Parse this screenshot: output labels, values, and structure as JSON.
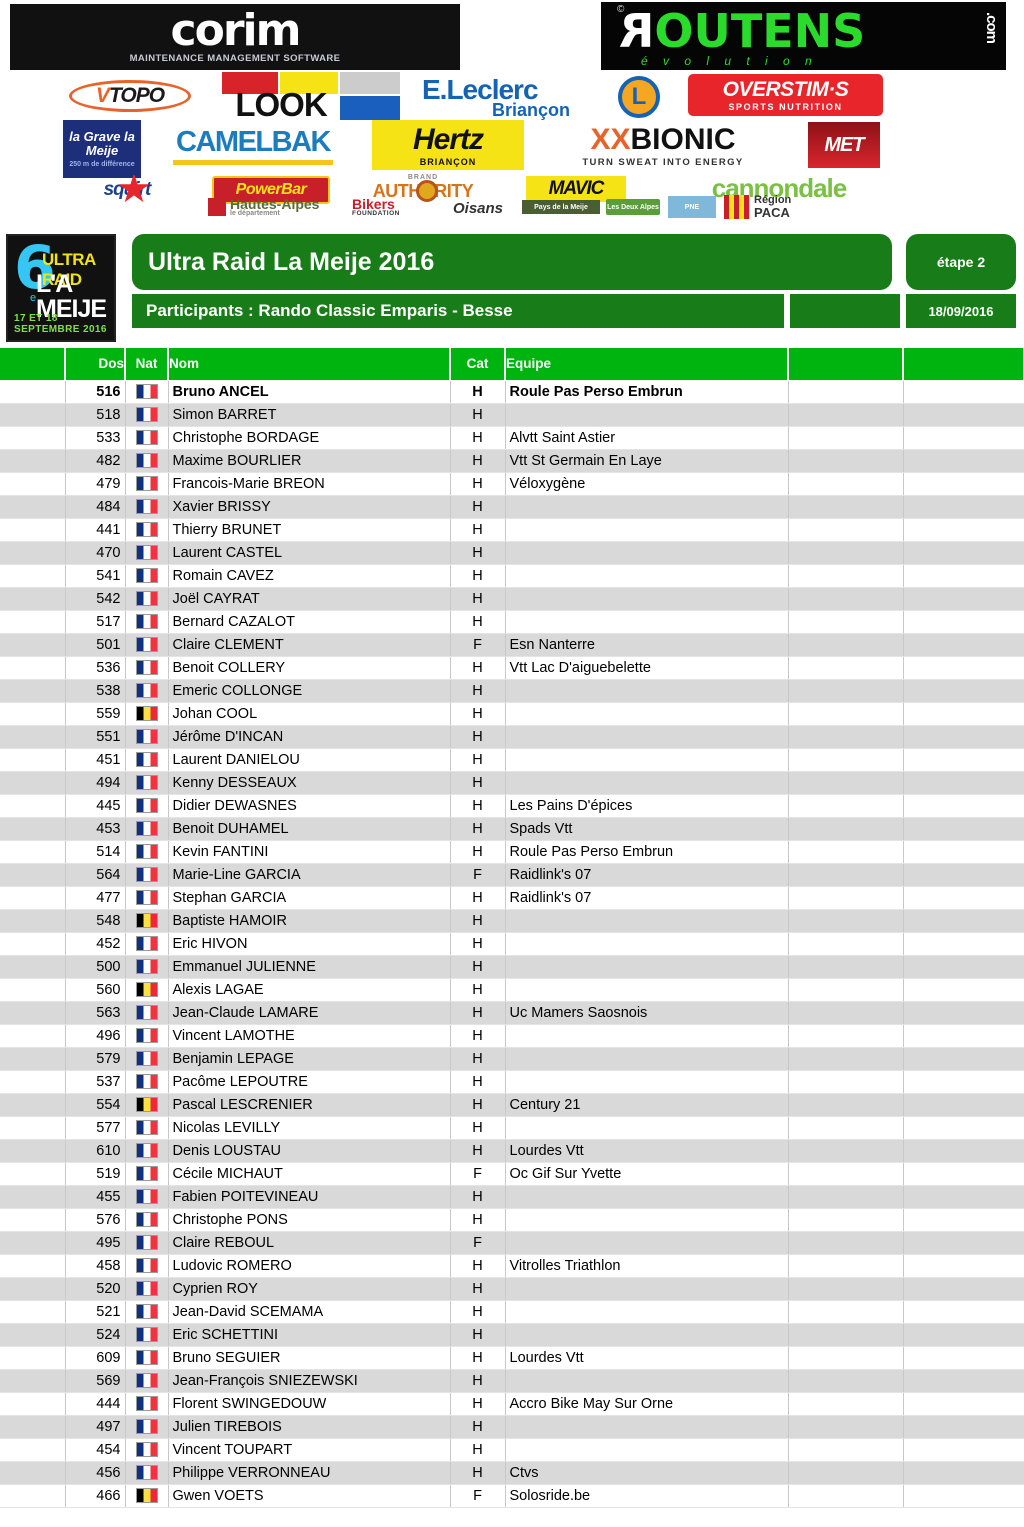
{
  "sponsors": {
    "corim": {
      "name": "corim",
      "tagline": "MAINTENANCE MANAGEMENT SOFTWARE"
    },
    "routens": {
      "name_part1": "R",
      "name_part2": "OUTENS",
      "suffix": ".com",
      "tagline": "é v o l u t i o n",
      "copyright": "©"
    },
    "vtopo": {
      "v": "V",
      "rest": "TOPO"
    },
    "look": {
      "name": "LOOK"
    },
    "leclerc": {
      "line1": "E.Leclerc",
      "line2": "Briançon",
      "mark": "L"
    },
    "overstims": {
      "line1": "OVERSTIM·S",
      "line2": "SPORTS NUTRITION"
    },
    "lagrave": {
      "line1": "la Grave la Meije",
      "line2": "250 m de différence"
    },
    "camelbak": {
      "name": "CAMELBAK"
    },
    "hertz": {
      "line1": "Hertz",
      "line2": "BRIANÇON"
    },
    "xbionic": {
      "x": "XX",
      "name": "BIONIC",
      "tagline": "TURN SWEAT INTO ENERGY"
    },
    "met": {
      "name": "MET"
    },
    "squirt": {
      "name": "squirt"
    },
    "powerbar": {
      "name": "PowerBar"
    },
    "authority": {
      "brand": "BRAND",
      "name": "AUTHORITY"
    },
    "mavic": {
      "name": "MAVIC"
    },
    "cannondale": {
      "name": "cannondale"
    },
    "hautes_alpes": {
      "line1": "Hautes-Alpes",
      "line2": "le département"
    },
    "bikers": {
      "line1": "Bikers",
      "line2": "FOUNDATION"
    },
    "oisans": {
      "name": "Oisans"
    },
    "green1": {
      "name": "Pays de la Meije"
    },
    "green2": {
      "name": "Les Deux Alpes"
    },
    "green3": {
      "name": "PNE"
    },
    "paca": {
      "line1": "Région",
      "line2": "PACA"
    }
  },
  "header": {
    "event_logo": {
      "number": "6",
      "ordinal": "e",
      "line1": "ULTRA RAID",
      "line2": "L'A MEIJE",
      "dates": "17 ET 18 SEPTEMBRE 2016"
    },
    "title": "Ultra Raid La Meije 2016",
    "stage": "étape 2",
    "subtitle": "Participants : Rando Classic Emparis - Besse",
    "blank_cell": "",
    "date": "18/09/2016"
  },
  "table": {
    "columns": [
      "",
      "Dos",
      "Nat",
      "Nom",
      "Cat",
      "Equipe",
      "",
      ""
    ],
    "rows": [
      {
        "blank": "",
        "dos": "516",
        "nat": "fr",
        "nom": "Bruno ANCEL",
        "cat": "H",
        "equipe": "Roule Pas Perso Embrun",
        "e1": "",
        "e2": "",
        "bold": true
      },
      {
        "blank": "",
        "dos": "518",
        "nat": "fr",
        "nom": "Simon BARRET",
        "cat": "H",
        "equipe": "",
        "e1": "",
        "e2": ""
      },
      {
        "blank": "",
        "dos": "533",
        "nat": "fr",
        "nom": "Christophe BORDAGE",
        "cat": "H",
        "equipe": "Alvtt Saint Astier",
        "e1": "",
        "e2": ""
      },
      {
        "blank": "",
        "dos": "482",
        "nat": "fr",
        "nom": "Maxime BOURLIER",
        "cat": "H",
        "equipe": "Vtt St Germain En Laye",
        "e1": "",
        "e2": ""
      },
      {
        "blank": "",
        "dos": "479",
        "nat": "fr",
        "nom": "Francois-Marie BREON",
        "cat": "H",
        "equipe": "Véloxygène",
        "e1": "",
        "e2": ""
      },
      {
        "blank": "",
        "dos": "484",
        "nat": "fr",
        "nom": "Xavier BRISSY",
        "cat": "H",
        "equipe": "",
        "e1": "",
        "e2": ""
      },
      {
        "blank": "",
        "dos": "441",
        "nat": "fr",
        "nom": "Thierry BRUNET",
        "cat": "H",
        "equipe": "",
        "e1": "",
        "e2": ""
      },
      {
        "blank": "",
        "dos": "470",
        "nat": "fr",
        "nom": "Laurent CASTEL",
        "cat": "H",
        "equipe": "",
        "e1": "",
        "e2": ""
      },
      {
        "blank": "",
        "dos": "541",
        "nat": "fr",
        "nom": "Romain CAVEZ",
        "cat": "H",
        "equipe": "",
        "e1": "",
        "e2": ""
      },
      {
        "blank": "",
        "dos": "542",
        "nat": "fr",
        "nom": "Joël CAYRAT",
        "cat": "H",
        "equipe": "",
        "e1": "",
        "e2": ""
      },
      {
        "blank": "",
        "dos": "517",
        "nat": "fr",
        "nom": "Bernard CAZALOT",
        "cat": "H",
        "equipe": "",
        "e1": "",
        "e2": ""
      },
      {
        "blank": "",
        "dos": "501",
        "nat": "fr",
        "nom": "Claire CLEMENT",
        "cat": "F",
        "equipe": "Esn Nanterre",
        "e1": "",
        "e2": ""
      },
      {
        "blank": "",
        "dos": "536",
        "nat": "fr",
        "nom": "Benoit COLLERY",
        "cat": "H",
        "equipe": "Vtt Lac D'aiguebelette",
        "e1": "",
        "e2": ""
      },
      {
        "blank": "",
        "dos": "538",
        "nat": "fr",
        "nom": "Emeric COLLONGE",
        "cat": "H",
        "equipe": "",
        "e1": "",
        "e2": ""
      },
      {
        "blank": "",
        "dos": "559",
        "nat": "be",
        "nom": "Johan COOL",
        "cat": "H",
        "equipe": "",
        "e1": "",
        "e2": ""
      },
      {
        "blank": "",
        "dos": "551",
        "nat": "fr",
        "nom": "Jérôme D'INCAN",
        "cat": "H",
        "equipe": "",
        "e1": "",
        "e2": ""
      },
      {
        "blank": "",
        "dos": "451",
        "nat": "fr",
        "nom": "Laurent DANIELOU",
        "cat": "H",
        "equipe": "",
        "e1": "",
        "e2": ""
      },
      {
        "blank": "",
        "dos": "494",
        "nat": "fr",
        "nom": "Kenny DESSEAUX",
        "cat": "H",
        "equipe": "",
        "e1": "",
        "e2": ""
      },
      {
        "blank": "",
        "dos": "445",
        "nat": "fr",
        "nom": "Didier DEWASNES",
        "cat": "H",
        "equipe": "Les Pains D'épices",
        "e1": "",
        "e2": ""
      },
      {
        "blank": "",
        "dos": "453",
        "nat": "fr",
        "nom": "Benoit DUHAMEL",
        "cat": "H",
        "equipe": "Spads Vtt",
        "e1": "",
        "e2": ""
      },
      {
        "blank": "",
        "dos": "514",
        "nat": "fr",
        "nom": "Kevin FANTINI",
        "cat": "H",
        "equipe": "Roule Pas Perso Embrun",
        "e1": "",
        "e2": ""
      },
      {
        "blank": "",
        "dos": "564",
        "nat": "fr",
        "nom": "Marie-Line GARCIA",
        "cat": "F",
        "equipe": "Raidlink's 07",
        "e1": "",
        "e2": ""
      },
      {
        "blank": "",
        "dos": "477",
        "nat": "fr",
        "nom": "Stephan GARCIA",
        "cat": "H",
        "equipe": "Raidlink's 07",
        "e1": "",
        "e2": ""
      },
      {
        "blank": "",
        "dos": "548",
        "nat": "be",
        "nom": "Baptiste HAMOIR",
        "cat": "H",
        "equipe": "",
        "e1": "",
        "e2": ""
      },
      {
        "blank": "",
        "dos": "452",
        "nat": "fr",
        "nom": "Eric HIVON",
        "cat": "H",
        "equipe": "",
        "e1": "",
        "e2": ""
      },
      {
        "blank": "",
        "dos": "500",
        "nat": "fr",
        "nom": "Emmanuel JULIENNE",
        "cat": "H",
        "equipe": "",
        "e1": "",
        "e2": ""
      },
      {
        "blank": "",
        "dos": "560",
        "nat": "be",
        "nom": "Alexis LAGAE",
        "cat": "H",
        "equipe": "",
        "e1": "",
        "e2": ""
      },
      {
        "blank": "",
        "dos": "563",
        "nat": "fr",
        "nom": "Jean-Claude LAMARE",
        "cat": "H",
        "equipe": "Uc Mamers Saosnois",
        "e1": "",
        "e2": ""
      },
      {
        "blank": "",
        "dos": "496",
        "nat": "fr",
        "nom": "Vincent LAMOTHE",
        "cat": "H",
        "equipe": "",
        "e1": "",
        "e2": ""
      },
      {
        "blank": "",
        "dos": "579",
        "nat": "fr",
        "nom": "Benjamin LEPAGE",
        "cat": "H",
        "equipe": "",
        "e1": "",
        "e2": ""
      },
      {
        "blank": "",
        "dos": "537",
        "nat": "fr",
        "nom": "Pacôme LEPOUTRE",
        "cat": "H",
        "equipe": "",
        "e1": "",
        "e2": ""
      },
      {
        "blank": "",
        "dos": "554",
        "nat": "be",
        "nom": "Pascal LESCRENIER",
        "cat": "H",
        "equipe": "Century 21",
        "e1": "",
        "e2": ""
      },
      {
        "blank": "",
        "dos": "577",
        "nat": "fr",
        "nom": "Nicolas LEVILLY",
        "cat": "H",
        "equipe": "",
        "e1": "",
        "e2": ""
      },
      {
        "blank": "",
        "dos": "610",
        "nat": "fr",
        "nom": "Denis LOUSTAU",
        "cat": "H",
        "equipe": "Lourdes Vtt",
        "e1": "",
        "e2": ""
      },
      {
        "blank": "",
        "dos": "519",
        "nat": "fr",
        "nom": "Cécile MICHAUT",
        "cat": "F",
        "equipe": "Oc Gif Sur Yvette",
        "e1": "",
        "e2": ""
      },
      {
        "blank": "",
        "dos": "455",
        "nat": "fr",
        "nom": "Fabien POITEVINEAU",
        "cat": "H",
        "equipe": "",
        "e1": "",
        "e2": ""
      },
      {
        "blank": "",
        "dos": "576",
        "nat": "fr",
        "nom": "Christophe PONS",
        "cat": "H",
        "equipe": "",
        "e1": "",
        "e2": ""
      },
      {
        "blank": "",
        "dos": "495",
        "nat": "fr",
        "nom": "Claire REBOUL",
        "cat": "F",
        "equipe": "",
        "e1": "",
        "e2": ""
      },
      {
        "blank": "",
        "dos": "458",
        "nat": "fr",
        "nom": "Ludovic ROMERO",
        "cat": "H",
        "equipe": "Vitrolles Triathlon",
        "e1": "",
        "e2": ""
      },
      {
        "blank": "",
        "dos": "520",
        "nat": "fr",
        "nom": "Cyprien ROY",
        "cat": "H",
        "equipe": "",
        "e1": "",
        "e2": ""
      },
      {
        "blank": "",
        "dos": "521",
        "nat": "fr",
        "nom": "Jean-David SCEMAMA",
        "cat": "H",
        "equipe": "",
        "e1": "",
        "e2": ""
      },
      {
        "blank": "",
        "dos": "524",
        "nat": "fr",
        "nom": "Eric SCHETTINI",
        "cat": "H",
        "equipe": "",
        "e1": "",
        "e2": ""
      },
      {
        "blank": "",
        "dos": "609",
        "nat": "fr",
        "nom": "Bruno SEGUIER",
        "cat": "H",
        "equipe": "Lourdes Vtt",
        "e1": "",
        "e2": ""
      },
      {
        "blank": "",
        "dos": "569",
        "nat": "fr",
        "nom": "Jean-François SNIEZEWSKI",
        "cat": "H",
        "equipe": "",
        "e1": "",
        "e2": ""
      },
      {
        "blank": "",
        "dos": "444",
        "nat": "fr",
        "nom": "Florent SWINGEDOUW",
        "cat": "H",
        "equipe": "Accro Bike May Sur Orne",
        "e1": "",
        "e2": ""
      },
      {
        "blank": "",
        "dos": "497",
        "nat": "fr",
        "nom": "Julien TIREBOIS",
        "cat": "H",
        "equipe": "",
        "e1": "",
        "e2": ""
      },
      {
        "blank": "",
        "dos": "454",
        "nat": "fr",
        "nom": "Vincent TOUPART",
        "cat": "H",
        "equipe": "",
        "e1": "",
        "e2": ""
      },
      {
        "blank": "",
        "dos": "456",
        "nat": "fr",
        "nom": "Philippe VERRONNEAU",
        "cat": "H",
        "equipe": "Ctvs",
        "e1": "",
        "e2": ""
      },
      {
        "blank": "",
        "dos": "466",
        "nat": "be",
        "nom": "Gwen VOETS",
        "cat": "F",
        "equipe": "Solosride.be",
        "e1": "",
        "e2": ""
      }
    ]
  },
  "colors": {
    "header_green": "#00b410",
    "banner_green": "#187d18",
    "row_alt": "#d9d9d9"
  }
}
